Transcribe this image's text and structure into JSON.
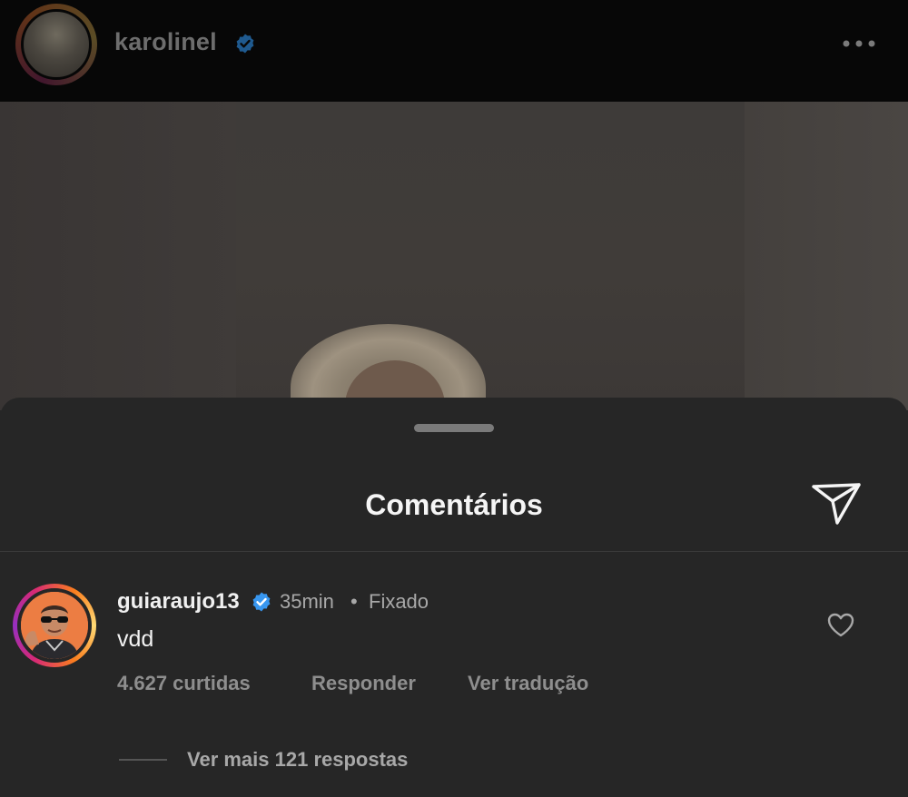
{
  "post": {
    "username": "karolinel",
    "verified": true
  },
  "comments_sheet": {
    "title": "Comentários"
  },
  "comment": {
    "username": "guiaraujo13",
    "verified": true,
    "time": "35min",
    "separator": "•",
    "pinned_label": "Fixado",
    "text": "vdd",
    "likes": "4.627 curtidas",
    "reply_label": "Responder",
    "translate_label": "Ver tradução",
    "view_replies": "Ver mais 121 respostas"
  },
  "colors": {
    "background": "#262626",
    "verified_blue": "#3897f0",
    "header_bg": "#070707"
  }
}
